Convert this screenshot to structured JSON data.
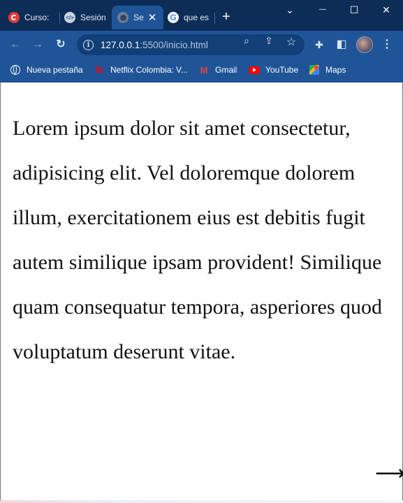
{
  "browser": {
    "tabs": [
      {
        "title": "Curso:",
        "icon": "red-circle-favicon",
        "active": false
      },
      {
        "title": "Sesión",
        "icon": "code-favicon",
        "active": false
      },
      {
        "title": "Se",
        "icon": "globe-favicon",
        "active": true
      },
      {
        "title": "que es",
        "icon": "google-favicon",
        "active": false
      }
    ],
    "new_tab_glyph": "+",
    "window_controls": {
      "menu": "⌄",
      "minimize": "—",
      "maximize": "☐",
      "close": "✕"
    },
    "toolbar": {
      "back_glyph": "←",
      "forward_glyph": "→",
      "reload_glyph": "↻",
      "url_host": "127.0.0.1",
      "url_rest": ":5500/inicio.html",
      "zoom_glyph": "⌕",
      "share_glyph": "⇪",
      "star_glyph": "☆",
      "extensions_glyph": "✚",
      "sidepanel_glyph": "◧",
      "menu_glyph": "⋮"
    },
    "bookmarks": [
      {
        "label": "Nueva pestaña",
        "icon": "globe-icon"
      },
      {
        "label": "Netflix Colombia: V...",
        "icon": "netflix-icon"
      },
      {
        "label": "Gmail",
        "icon": "gmail-icon"
      },
      {
        "label": "YouTube",
        "icon": "youtube-icon"
      },
      {
        "label": "Maps",
        "icon": "maps-icon"
      }
    ],
    "colors": {
      "frame": "#0d2d57",
      "toolbar": "#1f5597",
      "accent_red": "#e50914"
    }
  },
  "page": {
    "paragraph": "Lorem ipsum dolor sit amet consectetur, adipisicing elit. Vel doloremque dolorem illum, exercitationem eius est debitis fugit autem similique ipsam provident! Similique quam consequatur tempora, asperiores quod voluptatum deserunt vitae.",
    "arrow_glyph": "⟶"
  }
}
